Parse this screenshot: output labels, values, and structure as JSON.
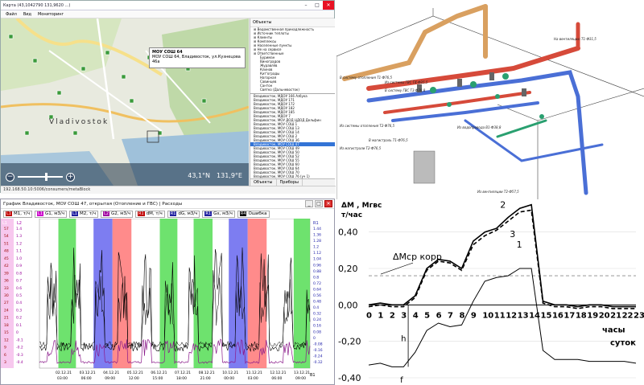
{
  "map_window": {
    "title": "Карта (43,1042790 131,9620 ...)",
    "menu": [
      "Файл",
      "Вид",
      "Мониторинг"
    ],
    "status_url": "192.168.50.10:5006/consumers/metaBlock",
    "coords": {
      "lat": "43,1°N",
      "lon": "131,9°E"
    },
    "city_label": "Vladivostok",
    "popup": {
      "title": "МОУ СОШ 64",
      "address": "МОУ СОШ 64, Владивосток, ул.Кузнецова 46а"
    },
    "objects_header": "Объекты",
    "tree": [
      {
        "label": "Ведомственная принадлежность",
        "sub": false
      },
      {
        "label": "Источник теплоты",
        "sub": false
      },
      {
        "label": "Клиенты",
        "sub": false
      },
      {
        "label": "Комплексы",
        "sub": false
      },
      {
        "label": "Населенные пункты",
        "sub": false
      },
      {
        "label": "Не на сервисе",
        "sub": false
      },
      {
        "label": "Ответственные",
        "sub": false
      },
      {
        "label": "Буриман",
        "sub": true
      },
      {
        "label": "Виноградов",
        "sub": true
      },
      {
        "label": "Журавлёв",
        "sub": true
      },
      {
        "label": "Клинов",
        "sub": true
      },
      {
        "label": "Кит'ограды",
        "sub": true
      },
      {
        "label": "Нагорная",
        "sub": true
      },
      {
        "label": "Савинцев",
        "sub": true
      },
      {
        "label": "Сантон",
        "sub": true
      },
      {
        "label": "Святко (Дальневосток)",
        "sub": true
      }
    ],
    "list": [
      "Владивосток, МДОУ 166 Азбука",
      "Владивосток, МДОУ 171",
      "Владивосток, МДОУ 172",
      "Владивосток, МДОУ 182",
      "Владивосток, МДОУ 185",
      "Владивосток, МДОУ 7",
      "Владивосток, МОУ ДОД ЦДОД Дельфин",
      "Владивосток, МОУ СОШ 1",
      "Владивосток, МОУ СОШ 13",
      "Владивосток, МОУ СОШ 14",
      "Владивосток, МОУ СОШ 2",
      "Владивосток, МОУ СОШ 36",
      "Владивосток, МОУ СОШ 47",
      "Владивосток, МОУ СОШ 49",
      "Владивосток, МОУ СОШ 50",
      "Владивосток, МОУ СОШ 52",
      "Владивосток, МОУ СОШ 55",
      "Владивосток, МОУ СОШ 60",
      "Владивосток, МОУ СОШ 64",
      "Владивосток, МОУ СОШ 70",
      "Владивосток, МОУ СОШ 76 (уч 1)",
      "Владивосток, МОУ СОШ 8 (уч 2)",
      "Владивосток, МОУ СОШ 80",
      "Владивосток, МОУ СОШ 82",
      "Владивосток, Окружной пр-т, 17",
      "Владивосток, Первомайский"
    ],
    "selected_list_index": 12,
    "tabs": [
      "Объекты",
      "Приборы"
    ]
  },
  "pipe_diagram": {
    "labels": [
      "В систему отопления Т1-Ф76,5",
      "Из системы ГВС Т4-Ф25,5",
      "В систему ГВС Т3-Ф38,8",
      "На вентиляцию Т1-Ф31,5",
      "Из системы отопления Т2-Ф76,5",
      "Из магистрали Т2-Ф76,5",
      "В магистраль Т1-Ф76,5",
      "Из водопровода В1-Ф38,8",
      "Из вентиляции Т2-Ф57,5"
    ]
  },
  "graph_window": {
    "title": "График Владивосток, МОУ СОШ 47, открытая (Отопление и ГВС) | Расходы",
    "legend": [
      {
        "tag": "L1",
        "label": "M1, т/ч",
        "color": "#c00000"
      },
      {
        "tag": "L1",
        "label": "G1, м3/ч",
        "color": "#cc00cc"
      },
      {
        "tag": "L1",
        "label": "M2, т/ч",
        "color": "#2020a0"
      },
      {
        "tag": "L2",
        "label": "G2, м3/ч",
        "color": "#a000a0"
      },
      {
        "tag": "R1",
        "label": "dM, т/ч",
        "color": "#c00000"
      },
      {
        "tag": "R1",
        "label": "dG, м3/ч",
        "color": "#2020a0"
      },
      {
        "tag": "R1",
        "label": "Gx, м3/ч",
        "color": "#2020a0"
      },
      {
        "tag": "R4",
        "label": "Ошибка",
        "color": "#000000"
      }
    ],
    "axis_left_tag": "L1",
    "axis_left2_tag": "L2",
    "axis_right_tag": "R1",
    "axis_bottom_tag": "B1",
    "left_ticks": [
      "57",
      "54",
      "51",
      "48",
      "45",
      "42",
      "39",
      "36",
      "33",
      "30",
      "27",
      "24",
      "21",
      "18",
      "15",
      "12",
      "9",
      "6",
      "3"
    ],
    "left2_ticks": [
      "1.4",
      "1.3",
      "1.2",
      "1.1",
      "1.0",
      "0.9",
      "0.8",
      "0.7",
      "0.6",
      "0.5",
      "0.4",
      "0.3",
      "0.2",
      "0.1",
      "0",
      "-0.1",
      "-0.2",
      "-0.3",
      "-0.4"
    ],
    "right_ticks": [
      "1.44",
      "1.36",
      "1.28",
      "1.2",
      "1.12",
      "1.04",
      "0.96",
      "0.88",
      "0.8",
      "0.72",
      "0.64",
      "0.56",
      "0.48",
      "0.4",
      "0.32",
      "0.24",
      "0.16",
      "0.08",
      "0",
      "-0.08",
      "-0.16",
      "-0.24",
      "-0.32"
    ],
    "x_ticks": [
      {
        "date": "02.12.21",
        "time": "03:00"
      },
      {
        "date": "03.12.21",
        "time": "06:00"
      },
      {
        "date": "04.12.21",
        "time": "09:00"
      },
      {
        "date": "05.12.21",
        "time": "12:00"
      },
      {
        "date": "06.12.21",
        "time": "15:00"
      },
      {
        "date": "07.12.21",
        "time": "18:00"
      },
      {
        "date": "08.12.21",
        "time": "21:00"
      },
      {
        "date": "10.12.21",
        "time": "00:00"
      },
      {
        "date": "11.12.21",
        "time": "03:00"
      },
      {
        "date": "12.12.21",
        "time": "06:00"
      },
      {
        "date": "13.12.21",
        "time": "09:00"
      }
    ],
    "bands": [
      {
        "color": "#55dd55",
        "from": 0.07,
        "to": 0.135
      },
      {
        "color": "#6666ee",
        "from": 0.2,
        "to": 0.27
      },
      {
        "color": "#ff7777",
        "from": 0.27,
        "to": 0.34
      },
      {
        "color": "#55dd55",
        "from": 0.445,
        "to": 0.51
      },
      {
        "color": "#55dd55",
        "from": 0.57,
        "to": 0.64
      },
      {
        "color": "#6666ee",
        "from": 0.7,
        "to": 0.77
      },
      {
        "color": "#ff7777",
        "from": 0.77,
        "to": 0.84
      },
      {
        "color": "#55dd55",
        "from": 0.94,
        "to": 1.0
      }
    ]
  },
  "chart_data": {
    "type": "line",
    "ylabel": "ΔM , Мгвс т/час",
    "xlabel": "часы суток",
    "x": [
      0,
      1,
      2,
      3,
      4,
      5,
      6,
      7,
      8,
      9,
      10,
      11,
      12,
      13,
      14,
      15,
      16,
      17,
      18,
      19,
      20,
      21,
      22,
      23
    ],
    "xlim": [
      0,
      23
    ],
    "ylim": [
      -0.4,
      0.5
    ],
    "yticks": [
      "0,40",
      "0,20",
      "0,00",
      "-0,20",
      "-0,40"
    ],
    "ytick_values": [
      0.4,
      0.2,
      0.0,
      -0.2,
      -0.4
    ],
    "series": [
      {
        "name": "1",
        "style": "solid-thin",
        "values": [
          -0.33,
          -0.32,
          -0.34,
          -0.34,
          -0.26,
          -0.14,
          -0.1,
          -0.12,
          -0.11,
          0.02,
          0.13,
          0.15,
          0.16,
          0.2,
          0.2,
          -0.25,
          -0.3,
          -0.3,
          -0.3,
          -0.31,
          -0.31,
          -0.31,
          -0.31,
          -0.32
        ]
      },
      {
        "name": "2",
        "style": "solid",
        "values": [
          0.0,
          0.01,
          0.0,
          0.0,
          0.05,
          0.2,
          0.25,
          0.24,
          0.2,
          0.35,
          0.4,
          0.42,
          0.48,
          0.53,
          0.55,
          0.02,
          0.0,
          0.0,
          -0.01,
          0.0,
          0.0,
          -0.01,
          -0.01,
          -0.01
        ]
      },
      {
        "name": "3",
        "style": "dashed",
        "values": [
          -0.01,
          0.0,
          -0.01,
          -0.01,
          0.04,
          0.19,
          0.24,
          0.23,
          0.19,
          0.33,
          0.38,
          0.41,
          0.46,
          0.51,
          0.52,
          0.01,
          -0.01,
          -0.01,
          -0.02,
          -0.01,
          -0.01,
          -0.02,
          -0.02,
          -0.02
        ]
      }
    ],
    "reference": {
      "label": "ΔMср корр",
      "value": 0.16
    },
    "annotations": [
      "h",
      "f"
    ]
  }
}
